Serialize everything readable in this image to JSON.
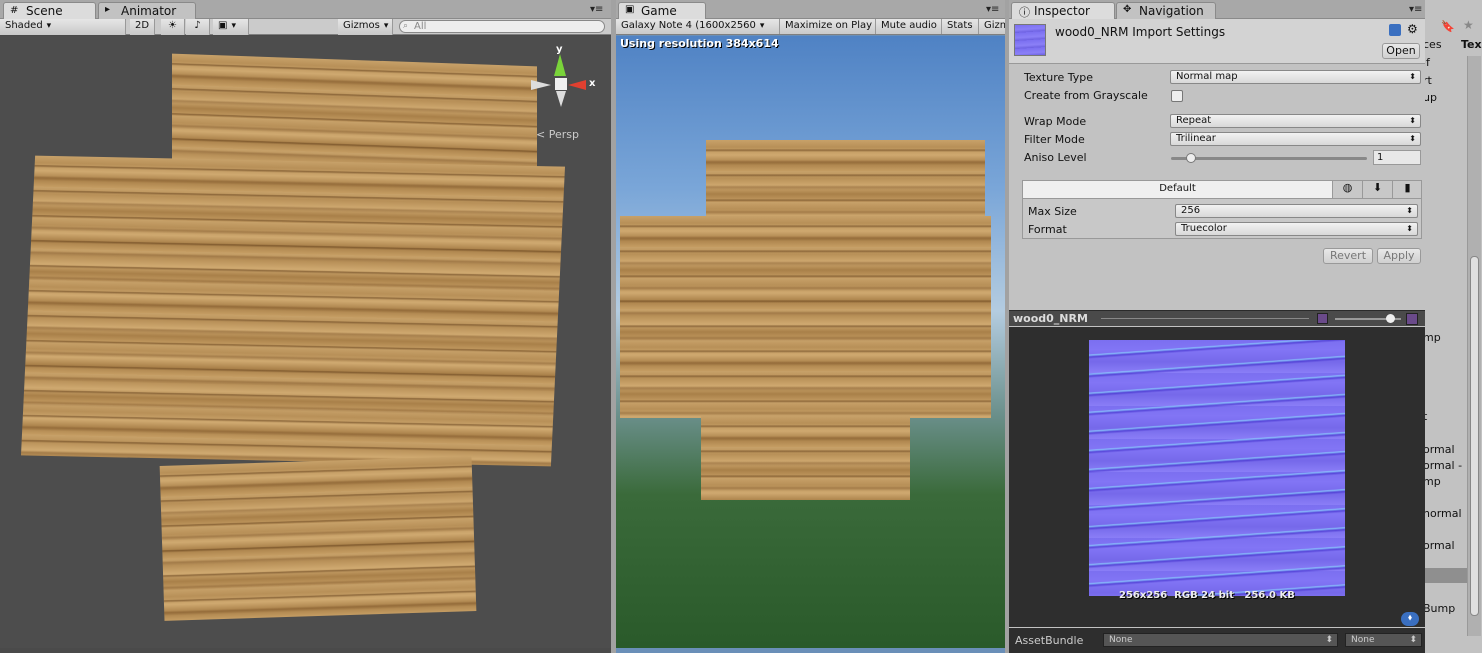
{
  "scene": {
    "tab": "Scene",
    "tab2": "Animator",
    "shading": "Shaded",
    "mode2d": "2D",
    "gizmos": "Gizmos",
    "search_placeholder": "All",
    "axis_x": "x",
    "axis_y": "y",
    "persp": "Persp"
  },
  "game": {
    "tab": "Game",
    "resolution_select": "Galaxy Note 4 (1600x2560",
    "maximize": "Maximize on Play",
    "mute": "Mute audio",
    "stats": "Stats",
    "gizmos": "Gizm",
    "overlay": "Using resolution 384x614"
  },
  "inspector": {
    "tab": "Inspector",
    "tab2": "Navigation",
    "title": "wood0_NRM Import Settings",
    "open_button": "Open",
    "fields": [
      {
        "label": "Texture Type",
        "value": "Normal map"
      },
      {
        "label": "Create from Grayscale"
      },
      {
        "label": "Wrap Mode",
        "value": "Repeat"
      },
      {
        "label": "Filter Mode",
        "value": "Trilinear"
      },
      {
        "label": "Aniso Level",
        "value": "1"
      }
    ],
    "aniso_fraction": 0.08,
    "platform_tab": "Default",
    "platform_fields": [
      {
        "label": "Max Size",
        "value": "256"
      },
      {
        "label": "Format",
        "value": "Truecolor"
      }
    ],
    "revert": "Revert",
    "apply": "Apply"
  },
  "preview": {
    "title": "wood0_NRM",
    "info": "256x256  RGB 24 bit   256.0 KB",
    "mip_fraction": 0.9
  },
  "assetbundle": {
    "label": "AssetBundle",
    "value1": "None",
    "value2": "None"
  },
  "right_panel": {
    "partial_texts": [
      "ces",
      "Tex",
      "lf",
      "rt",
      "up",
      "mp",
      "t",
      "ormal",
      "ormal -",
      "mp",
      "normal",
      "ormal",
      "Bump"
    ]
  }
}
